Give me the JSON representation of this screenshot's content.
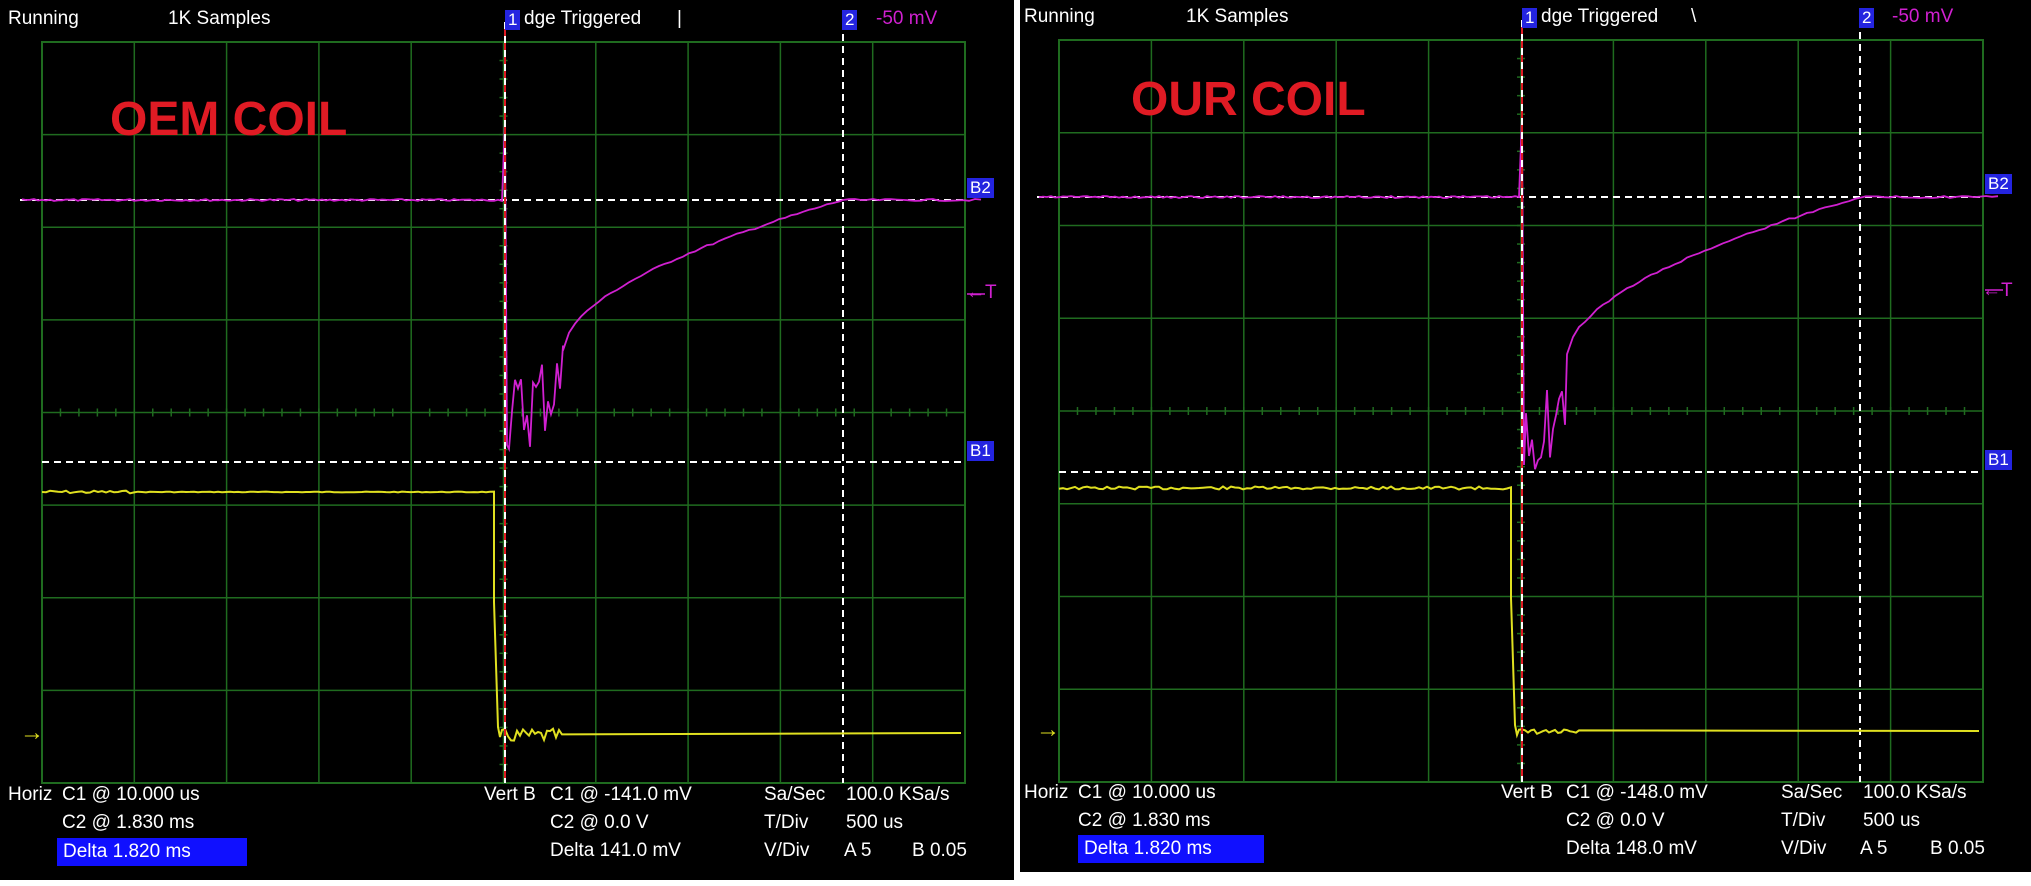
{
  "panels": [
    {
      "status": "Running",
      "samples": "1K Samples",
      "cursor1": "1",
      "trigger": "dge Triggered",
      "trigger_icon": "|",
      "cursor2": "2",
      "cursor2_value": "-50 mV",
      "overlay": "OEM COIL",
      "b2": "B2",
      "b1": "B1",
      "t_marker": "←T",
      "ground_marker": "→",
      "horiz": "Horiz",
      "h_c1": "C1 @ 10.000 us",
      "h_c2": "C2 @ 1.830 ms",
      "h_delta": "Delta 1.820 ms",
      "vert": "Vert B",
      "v_c1": "C1 @ -141.0 mV",
      "v_c2": "C2 @ 0.0  V",
      "v_delta": "Delta 141.0 mV",
      "sa_label": "Sa/Sec",
      "sa_value": "100.0 KSa/s",
      "tdiv_label": "T/Div",
      "tdiv_value": "500 us",
      "vdiv_label": "V/Div",
      "vdiv_a": "A 5",
      "vdiv_b": "B 0.05"
    },
    {
      "status": "Running",
      "samples": "1K Samples",
      "cursor1": "1",
      "trigger": "dge Triggered",
      "trigger_icon": "\\",
      "cursor2": "2",
      "cursor2_value": "-50 mV",
      "overlay": "OUR COIL",
      "b2": "B2",
      "b1": "B1",
      "t_marker": "←T",
      "ground_marker": "→",
      "horiz": "Horiz",
      "h_c1": "C1 @ 10.000 us",
      "h_c2": "C2 @ 1.830 ms",
      "h_delta": "Delta 1.820 ms",
      "vert": "Vert B",
      "v_c1": "C1 @ -148.0 mV",
      "v_c2": "C2 @ 0.0  V",
      "v_delta": "Delta 148.0 mV",
      "sa_label": "Sa/Sec",
      "sa_value": "100.0 KSa/s",
      "tdiv_label": "T/Div",
      "tdiv_value": "500 us",
      "vdiv_label": "V/Div",
      "vdiv_a": "A 5",
      "vdiv_b": "B 0.05"
    }
  ],
  "colors": {
    "background": "#000000",
    "grid": "#1f6b1f",
    "channel_a": "#e0e020",
    "channel_b": "#d020d0",
    "cursor": "#ffffff",
    "trigger_cursor": "#e01b24",
    "overlay_text": "#e01b24",
    "badge": "#2424e0"
  }
}
